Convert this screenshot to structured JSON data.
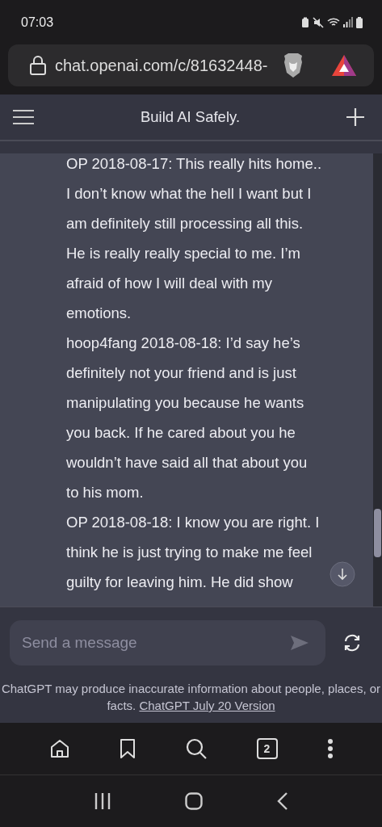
{
  "status_bar": {
    "time": "07:03"
  },
  "browser": {
    "url": "chat.openai.com/c/81632448-"
  },
  "header": {
    "title": "Build AI Safely."
  },
  "message": {
    "paragraphs": [
      {
        "lines": [
          "OP 2018-08-17: This really hits home..",
          "I don’t know what the hell I want but I",
          "am definitely still processing all this.",
          "He is really really special to me. I’m",
          "afraid of how I will deal with my",
          "emotions."
        ]
      },
      {
        "lines": [
          "hoop4fang 2018-08-18: I’d say he’s",
          "definitely not your friend and is just",
          "manipulating you because he wants",
          "you back. If he cared about you he",
          "wouldn’t have said all that about you",
          "to his mom."
        ]
      },
      {
        "lines": [
          "OP 2018-08-18: I know you are right. I",
          "think he is just trying to make me feel",
          "guilty for leaving him. He did show"
        ]
      }
    ]
  },
  "composer": {
    "placeholder": "Send a message"
  },
  "disclaimer": {
    "text": "ChatGPT may produce inaccurate information about people, places, or facts.",
    "link": "ChatGPT July 20 Version"
  },
  "browser_toolbar": {
    "tab_count": "2"
  }
}
